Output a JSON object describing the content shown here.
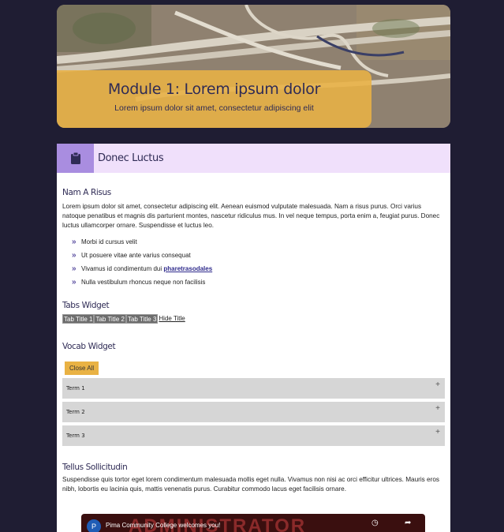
{
  "hero": {
    "title": "Module 1: Lorem ipsum dolor",
    "subtitle": "Lorem ipsum dolor sit amet, consectetur adipiscing elit"
  },
  "card": {
    "header_title": "Donec Luctus",
    "header_icon": "clipboard-icon",
    "colors": {
      "accent": "#a98de0",
      "header_bg": "#f0e0fb",
      "gold": "#e9b244",
      "navy": "#2f2b55"
    }
  },
  "section1": {
    "heading": "Nam A Risus",
    "paragraph": "Lorem ipsum dolor sit amet, consectetur adipiscing elit. Aenean euismod vulputate malesuada. Nam a risus purus. Orci varius natoque penatibus et magnis dis parturient montes, nascetur ridiculus mus. In vel neque tempus, porta enim a, feugiat purus. Donec luctus ullamcorper ornare. Suspendisse et luctus leo.",
    "bullets": [
      {
        "text": "Morbi id cursus velit"
      },
      {
        "text": "Ut posuere vitae ante varius consequat"
      },
      {
        "prefix": "Vivamus id condimentum dui ",
        "link": "pharetrasodales"
      },
      {
        "text": "Nulla vestibulum rhoncus neque non facilisis"
      }
    ]
  },
  "tabs_widget": {
    "heading": "Tabs Widget",
    "tabs": [
      "Tab Title 1",
      "Tab Title 2",
      "Tab Title 3"
    ],
    "hide_link": "Hide Title"
  },
  "vocab_widget": {
    "heading": "Vocab Widget",
    "close_all": "Close All",
    "terms": [
      "Term 1",
      "Term 2",
      "Term 3"
    ]
  },
  "section2": {
    "heading": "Tellus Sollicitudin",
    "paragraph": "Suspendisse quis tortor eget lorem condimentum malesuada mollis eget nulla. Vivamus non nisi ac orci efficitur ultrices. Mauris eros nibh, lobortis eu lacinia quis, mattis venenatis purus. Curabitur commodo lacus eget facilisis ornare."
  },
  "video": {
    "channel_initial": "P",
    "title": "Pima Community College welcomes you!",
    "background_text": "ADMINISTRATOR"
  }
}
